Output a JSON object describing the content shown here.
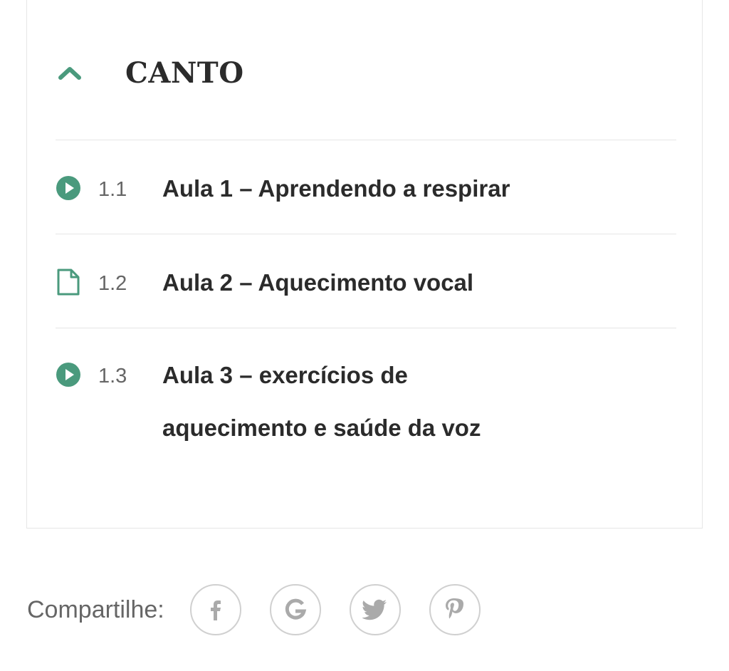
{
  "section": {
    "title": "CANTO",
    "icon": "chevron-up-icon",
    "accent_color": "#4a9a7d"
  },
  "lessons": [
    {
      "number": "1.1",
      "title": "Aula 1 – Aprendendo a respirar",
      "icon": "play-circle-icon"
    },
    {
      "number": "1.2",
      "title": "Aula 2 – Aquecimento vocal",
      "icon": "document-icon"
    },
    {
      "number": "1.3",
      "title": "Aula 3 – exercícios de aquecimento e saúde da voz",
      "icon": "play-circle-icon"
    }
  ],
  "share": {
    "label": "Compartilhe:",
    "buttons": [
      "facebook-icon",
      "google-icon",
      "twitter-icon",
      "pinterest-icon"
    ]
  }
}
